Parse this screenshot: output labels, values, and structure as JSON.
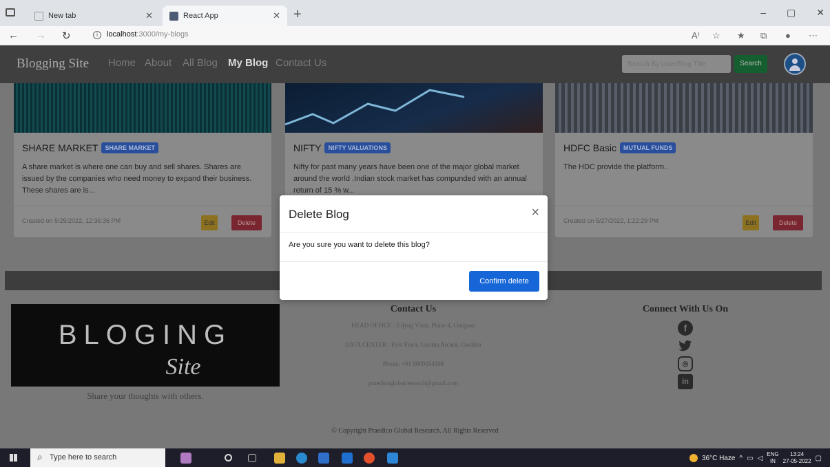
{
  "browser": {
    "tabs": [
      {
        "label": "New tab",
        "active": false
      },
      {
        "label": "React App",
        "active": true
      }
    ],
    "url_host": "localhost",
    "url_path": ":3000/my-blogs",
    "window_controls": [
      "–",
      "▢",
      "✕"
    ]
  },
  "navbar": {
    "brand": "Blogging Site",
    "links": [
      "Home",
      "About",
      "All Blog",
      "My Blog",
      "Contact Us"
    ],
    "active_link": "My Blog",
    "search_placeholder": "Search By User/Blog Title",
    "search_button": "Search"
  },
  "cards": [
    {
      "title": "SHARE MARKET",
      "badge": "SHARE MARKET",
      "body": "A share market is where one can buy and sell shares. Shares are issued by the companies who need money to expand their business. These shares are is...",
      "date": "Created on 5/25/2022, 12:36:36 PM",
      "edit_label": "Edit",
      "delete_label": "Delete"
    },
    {
      "title": "NIFTY",
      "badge": "NIFTY VALUATIONS",
      "body": "Nifty for past many years have been one of the major global market around the world .Indian stock market has compunded with an annual return of 15 % w..."
    },
    {
      "title": "HDFC Basic",
      "badge": "MUTUAL FUNDS",
      "body": "The HDC provide the platform..",
      "date": "Created on 5/27/2022, 1:22:29 PM",
      "edit_label": "Edit",
      "delete_label": "Delete"
    }
  ],
  "footer": {
    "logo_text_top": "BLOGING",
    "logo_text_script": "Site",
    "tagline": "Share your thoughts with others.",
    "contact_title": "Contact Us",
    "contact_lines": [
      "HEAD OFFICE : Udyog Vihar, Phase 4, Gurgaon",
      "DATA CENTER : First Floor, Garima Arcade, Gwalior",
      "Phone: +91 9009054508",
      "praedicoglobalresearch@gmail.com"
    ],
    "connect_title": "Connect With Us On",
    "social_icons": [
      "facebook-icon",
      "twitter-icon",
      "instagram-icon",
      "linkedin-icon"
    ],
    "copyright": "© Copyright Praedico Global Research. All Rights Reserved"
  },
  "modal": {
    "title": "Delete Blog",
    "close": "×",
    "message": "Are you sure you want to delete this blog?",
    "confirm_label": "Confirm delete"
  },
  "taskbar": {
    "search_placeholder": "Type here to search",
    "weather": "36°C Haze",
    "lang_top": "ENG",
    "lang_bottom": "IN",
    "time": "13:24",
    "date": "27-05-2022"
  }
}
